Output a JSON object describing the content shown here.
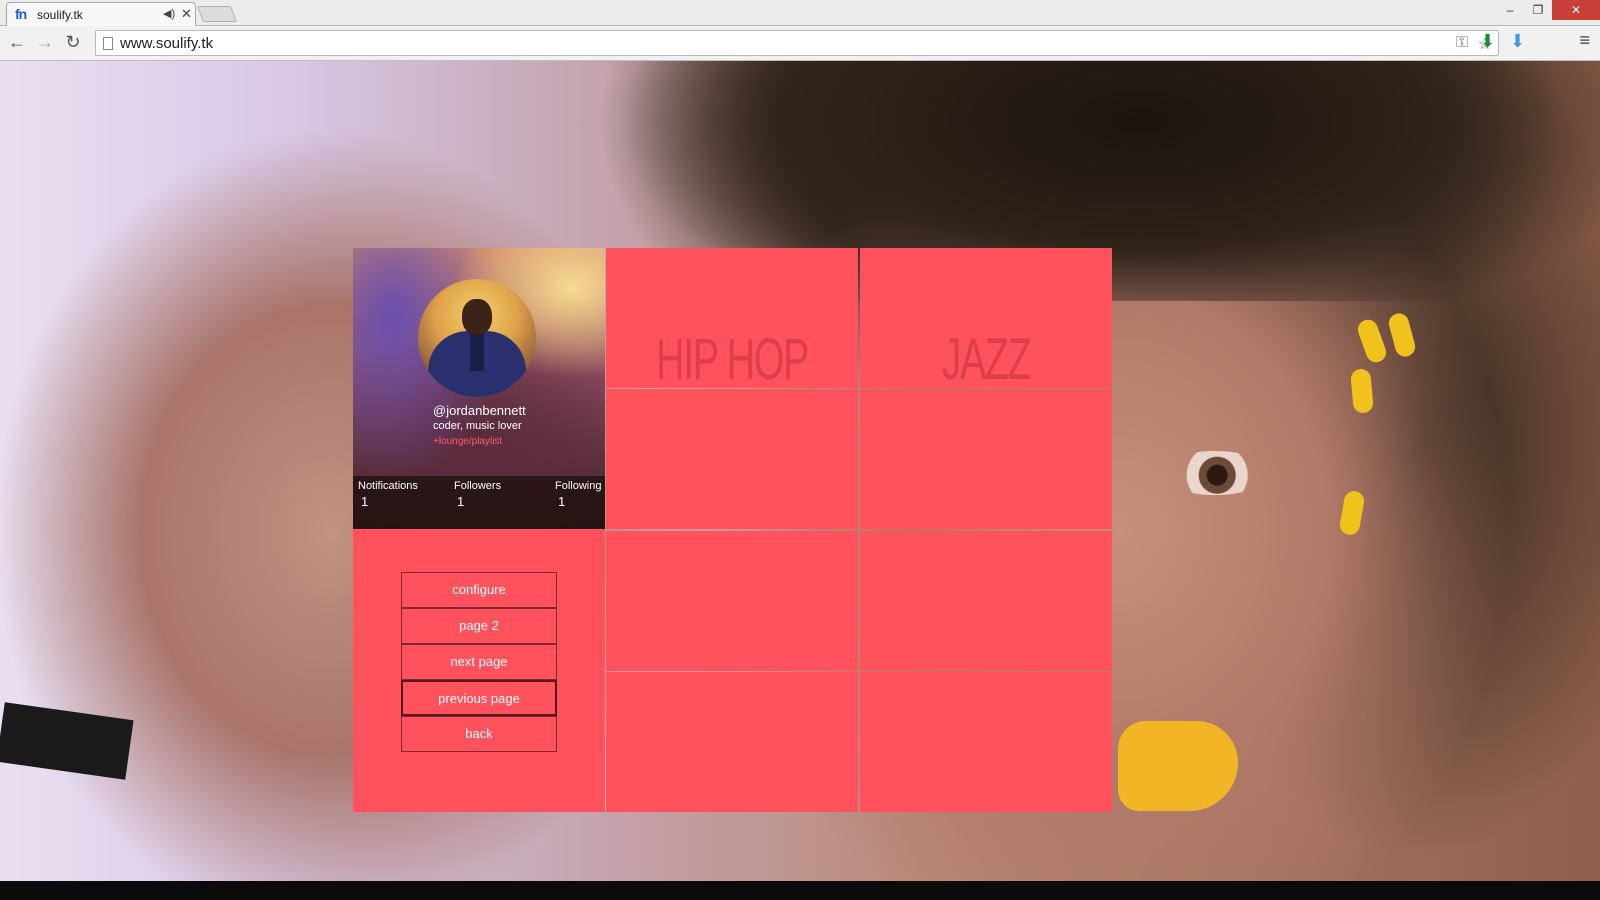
{
  "browser": {
    "tab": {
      "favicon": "fn",
      "title": "soulify.tk",
      "audio_icon": "speaker-icon",
      "close_icon": "close-icon"
    },
    "window_controls": {
      "minimize": "–",
      "restore": "❐",
      "close": "✕"
    },
    "toolbar": {
      "back": "←",
      "forward": "→",
      "reload": "↻",
      "url": "www.soulify.tk",
      "extensions": [
        "key-icon",
        "star-icon",
        "download-green-icon",
        "download-blue-icon"
      ],
      "menu": "≡"
    }
  },
  "profile": {
    "handle": "@jordanbennett",
    "bio": "coder, music lover",
    "playlist_link": "+lounge/playlist",
    "stats": [
      {
        "label": "Notifications",
        "value": "1"
      },
      {
        "label": "Followers",
        "value": "1"
      },
      {
        "label": "Following",
        "value": "1"
      }
    ]
  },
  "menu": {
    "items": [
      {
        "label": "configure"
      },
      {
        "label": "page 2"
      },
      {
        "label": "next page"
      },
      {
        "label": "previous page"
      },
      {
        "label": "back"
      }
    ]
  },
  "genres": {
    "tiles": [
      {
        "label": "HIP HOP"
      },
      {
        "label": "JAZZ"
      },
      {
        "label": ""
      },
      {
        "label": ""
      },
      {
        "label": ""
      },
      {
        "label": ""
      },
      {
        "label": ""
      },
      {
        "label": ""
      }
    ]
  },
  "colors": {
    "accent": "#ff525c",
    "link": "#ff5a6c",
    "window_close": "#c94039"
  }
}
